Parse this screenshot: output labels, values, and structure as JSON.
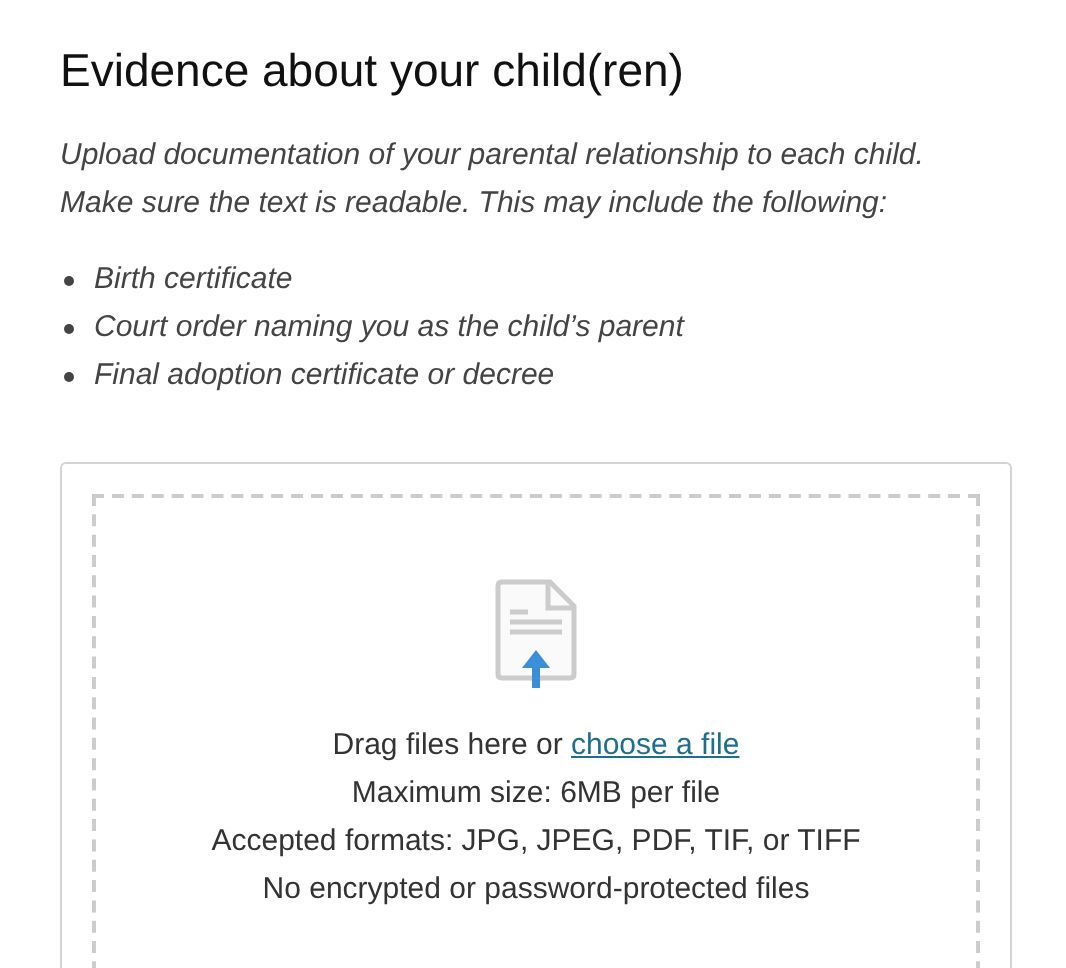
{
  "title": "Evidence about your child(ren)",
  "intro": [
    "Upload documentation of your parental relationship to each child.",
    "Make sure the text is readable. This may include the following:"
  ],
  "examples": [
    "Birth certificate",
    "Court order naming you as the child’s parent",
    "Final adoption certificate or decree"
  ],
  "drop_zone": {
    "prompt": "Drag files here or",
    "link": "choose a file",
    "notes": [
      "Maximum size: 6MB per file",
      "Accepted formats: JPG, JPEG, PDF, TIF, or TIFF",
      "No encrypted or password-protected files"
    ]
  }
}
